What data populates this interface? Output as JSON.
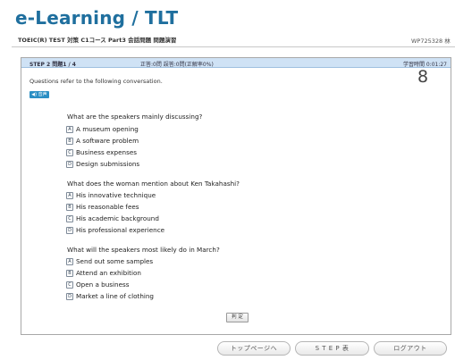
{
  "header": {
    "app_title": "e-Learning / TLT",
    "course_title": "TOEIC(R) TEST 対策 C1コース Part3 会話問題 問題演習",
    "user_id": "WP725328 林"
  },
  "status_bar": {
    "step": "STEP 2 問題1 / 4",
    "score": "正答:0問 誤答:0問(正解率0%)",
    "time": "学習時間 0:01:27"
  },
  "content": {
    "instruction": "Questions refer to the following conversation.",
    "audio_label": "◀) 音声",
    "question_number": "8",
    "questions": [
      {
        "text": "What are the speakers mainly discussing?",
        "options": [
          {
            "letter": "A",
            "text": "A museum opening"
          },
          {
            "letter": "B",
            "text": "A software problem"
          },
          {
            "letter": "C",
            "text": "Business expenses"
          },
          {
            "letter": "D",
            "text": "Design submissions"
          }
        ]
      },
      {
        "text": "What does the woman mention about Ken Takahashi?",
        "options": [
          {
            "letter": "A",
            "text": "His innovative technique"
          },
          {
            "letter": "B",
            "text": "His reasonable fees"
          },
          {
            "letter": "C",
            "text": "His academic background"
          },
          {
            "letter": "D",
            "text": "His professional experience"
          }
        ]
      },
      {
        "text": "What will the speakers most likely do in March?",
        "options": [
          {
            "letter": "A",
            "text": "Send out some samples"
          },
          {
            "letter": "B",
            "text": "Attend an exhibition"
          },
          {
            "letter": "C",
            "text": "Open a business"
          },
          {
            "letter": "D",
            "text": "Market a line of clothing"
          }
        ]
      }
    ],
    "judge_label": "判 定"
  },
  "footer": {
    "top_page_label": "トップページへ",
    "step_table_label": "S T E P 表",
    "logout_label": "ログアウト"
  }
}
